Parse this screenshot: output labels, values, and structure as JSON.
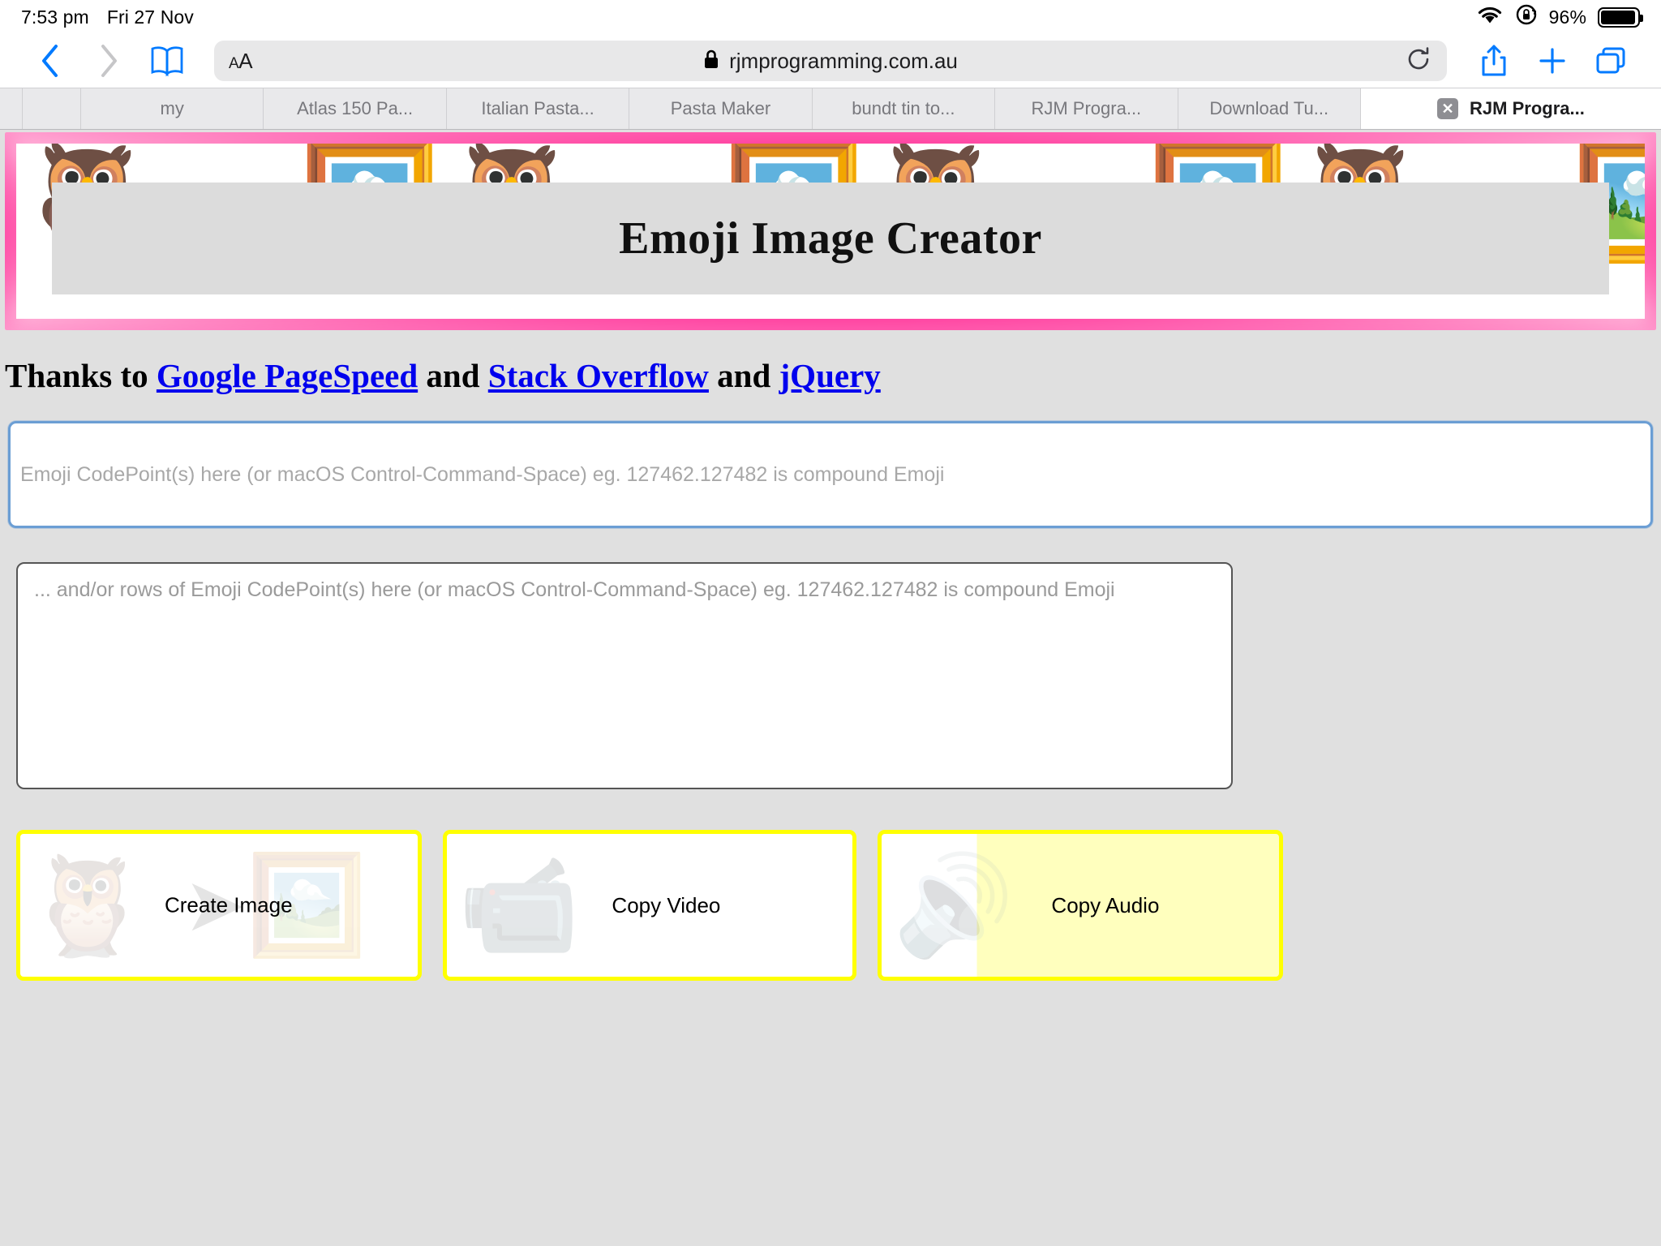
{
  "status_bar": {
    "time": "7:53 pm",
    "date": "Fri 27 Nov",
    "wifi_icon": "wifi-icon",
    "rotation_lock_icon": "rotation-lock-icon",
    "battery_percent": "96%"
  },
  "toolbar": {
    "back_icon": "chevron-left-icon",
    "forward_icon": "chevron-right-icon",
    "bookmarks_icon": "book-icon",
    "text_size_label": "AA",
    "lock_icon": "lock-icon",
    "url": "rjmprogramming.com.au",
    "reload_icon": "reload-icon",
    "share_icon": "share-icon",
    "new_tab_icon": "plus-icon",
    "tabs_icon": "tabs-icon"
  },
  "tabs": [
    {
      "label": "",
      "kind": "tiny"
    },
    {
      "label": "",
      "kind": "narrow"
    },
    {
      "label": "my",
      "kind": "normal"
    },
    {
      "label": "Atlas 150 Pa...",
      "kind": "normal"
    },
    {
      "label": "Italian Pasta...",
      "kind": "normal"
    },
    {
      "label": "Pasta Maker",
      "kind": "normal"
    },
    {
      "label": "bundt tin to...",
      "kind": "normal"
    },
    {
      "label": "RJM Progra...",
      "kind": "normal"
    },
    {
      "label": "Download Tu...",
      "kind": "normal"
    },
    {
      "label": "RJM Progra...",
      "kind": "active",
      "close_icon": "close-icon",
      "close_label": "✕"
    }
  ],
  "page": {
    "banner": {
      "title": "Emoji Image Creator",
      "border_color": "#ff2d96",
      "title_bg": "#dcdcdc",
      "emoji_pattern": [
        "🦉",
        "➖",
        "🖼️",
        "🦉",
        "➖",
        "🖼️",
        "🦉",
        "➖",
        "🖼️",
        "🦉",
        "➖",
        "🖼️"
      ]
    },
    "thanks": {
      "prefix": "Thanks to ",
      "link1": "Google PageSpeed",
      "sep1": " and ",
      "link2": "Stack Overflow",
      "sep2": " and ",
      "link3": "jQuery",
      "link_color": "#0000ee"
    },
    "emoji_input": {
      "placeholder": "Emoji CodePoint(s) here (or macOS Control-Command-Space) eg. 127462.127482 is compound Emoji",
      "value": "",
      "focus_border_color": "#6b9ed4"
    },
    "emoji_textarea": {
      "placeholder": "... and/or rows of Emoji CodePoint(s) here (or macOS Control-Command-Space) eg. 127462.127482 is compound Emoji",
      "value": ""
    },
    "buttons": [
      {
        "label": "Create Image",
        "left_icon": "owl-icon",
        "left_glyph": "🦉",
        "arrow_glyph": "➤",
        "right_icon": "framed-picture-icon",
        "right_glyph": "🖼️",
        "border_color": "#ffff00",
        "background": "#ffffff"
      },
      {
        "label": "Copy Video",
        "left_icon": "video-camera-icon",
        "left_glyph": "📹",
        "border_color": "#ffff00",
        "background": "#ffffff"
      },
      {
        "label": "Copy Audio",
        "left_icon": "speaker-icon",
        "left_glyph": "🔊",
        "border_color": "#ffff00",
        "background": "#ffffbe"
      }
    ]
  }
}
